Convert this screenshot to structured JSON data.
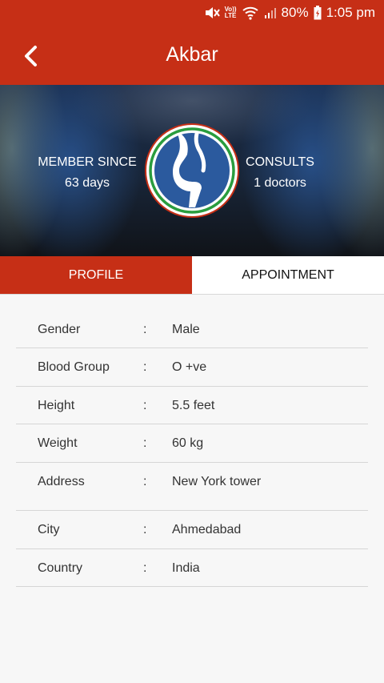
{
  "status_bar": {
    "volte_top": "Vo))",
    "volte_bottom": "LTE",
    "battery": "80%",
    "time": "1:05 pm"
  },
  "app_bar": {
    "title": "Akbar"
  },
  "hero": {
    "member_since_label": "MEMBER SINCE",
    "member_since_value": "63 days",
    "consults_label": "CONSULTS",
    "consults_value": "1 doctors"
  },
  "tabs": [
    {
      "label": "PROFILE",
      "active": true
    },
    {
      "label": "APPOINTMENT",
      "active": false
    }
  ],
  "profile": [
    {
      "label": "Gender",
      "sep": ":",
      "value": "Male"
    },
    {
      "label": "Blood Group",
      "sep": ":",
      "value": "O +ve"
    },
    {
      "label": "Height",
      "sep": ":",
      "value": "5.5 feet"
    },
    {
      "label": "Weight",
      "sep": ":",
      "value": "60 kg"
    },
    {
      "label": "Address",
      "sep": ":",
      "value": "New York tower"
    },
    {
      "label": "City",
      "sep": ":",
      "value": "Ahmedabad"
    },
    {
      "label": "Country",
      "sep": ":",
      "value": "India"
    }
  ],
  "colors": {
    "primary": "#c62f16",
    "logo_blue": "#2b5a9e",
    "logo_green": "#2a9d3e"
  }
}
